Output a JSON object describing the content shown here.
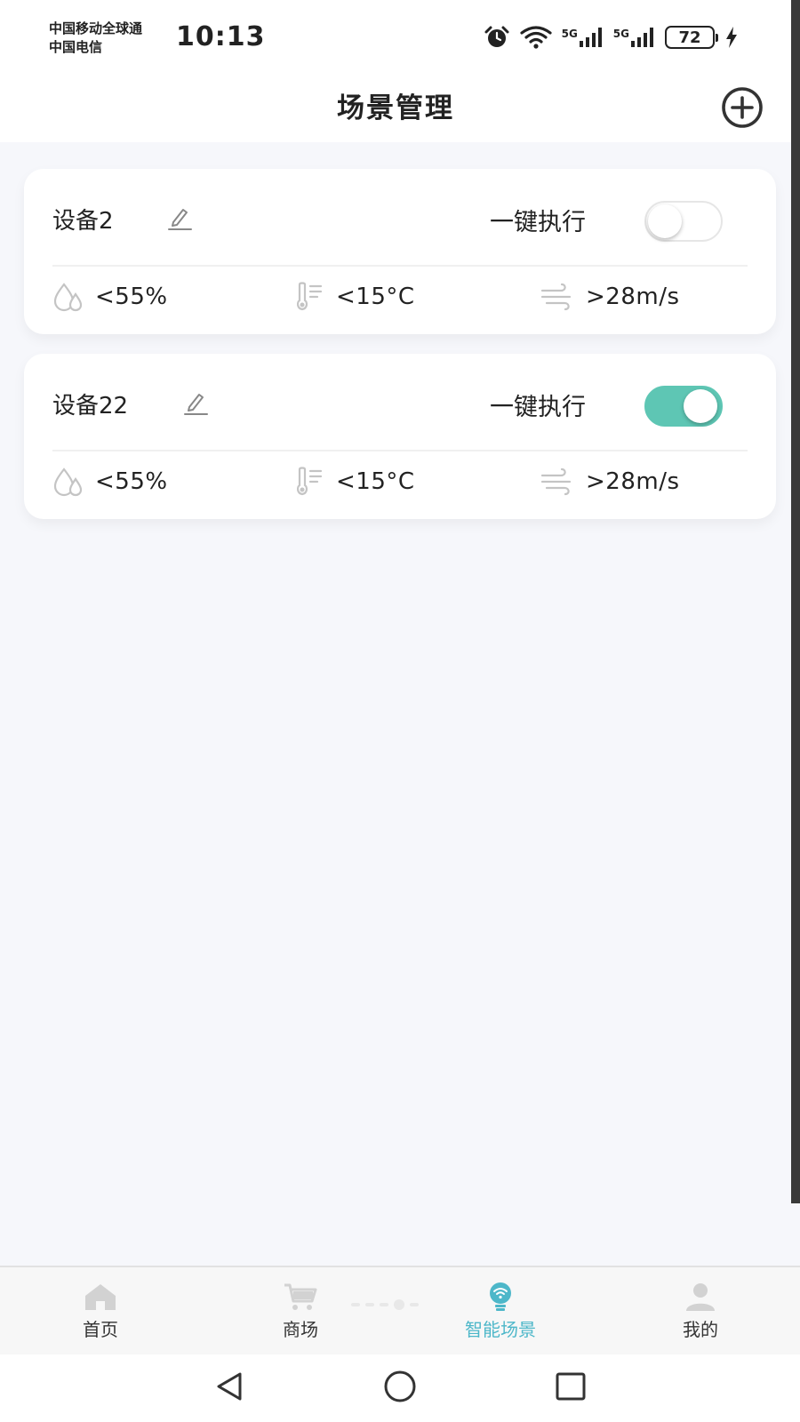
{
  "status_bar": {
    "carrier_line1": "中国移动全球通",
    "carrier_line2": "中国电信",
    "time": "10:13",
    "signal1_label": "5G",
    "signal2_label": "5G",
    "battery": "72"
  },
  "header": {
    "title": "场景管理",
    "add_icon": "plus-circle-icon"
  },
  "scenes": [
    {
      "name": "设备2",
      "exec_label": "一键执行",
      "enabled": false,
      "humidity": "<55%",
      "temperature": "<15°C",
      "wind": ">28m/s"
    },
    {
      "name": "设备22",
      "exec_label": "一键执行",
      "enabled": true,
      "humidity": "<55%",
      "temperature": "<15°C",
      "wind": ">28m/s"
    }
  ],
  "bottom_nav": [
    {
      "label": "首页",
      "icon": "home-icon",
      "active": false
    },
    {
      "label": "商场",
      "icon": "cart-icon",
      "active": false
    },
    {
      "label": "智能场景",
      "icon": "bulb-wifi-icon",
      "active": true
    },
    {
      "label": "我的",
      "icon": "user-icon",
      "active": false
    }
  ],
  "colors": {
    "accent": "#4db7c9",
    "toggle_on": "#5ec6b4",
    "background": "#f6f7fb",
    "card": "#ffffff",
    "icon_gray": "#c4c4c4"
  }
}
